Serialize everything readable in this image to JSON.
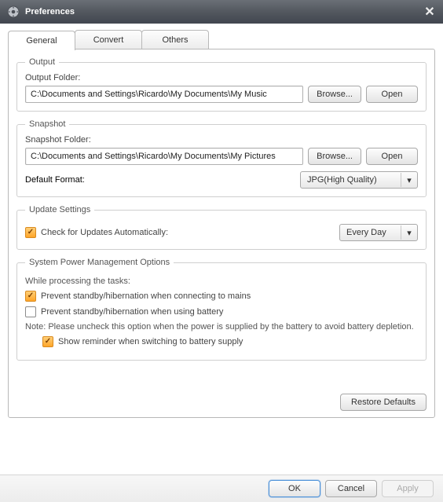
{
  "title": "Preferences",
  "tabs": {
    "general": "General",
    "convert": "Convert",
    "others": "Others"
  },
  "output": {
    "legend": "Output",
    "folder_label": "Output Folder:",
    "folder_value": "C:\\Documents and Settings\\Ricardo\\My Documents\\My Music",
    "browse": "Browse...",
    "open": "Open"
  },
  "snapshot": {
    "legend": "Snapshot",
    "folder_label": "Snapshot Folder:",
    "folder_value": "C:\\Documents and Settings\\Ricardo\\My Documents\\My Pictures",
    "browse": "Browse...",
    "open": "Open",
    "default_format_label": "Default Format:",
    "default_format_value": "JPG(High Quality)"
  },
  "update": {
    "legend": "Update Settings",
    "check_label": "Check for Updates Automatically:",
    "check_checked": true,
    "freq_value": "Every Day"
  },
  "power": {
    "legend": "System Power Management Options",
    "while_label": "While processing the tasks:",
    "opt1_label": "Prevent standby/hibernation when connecting to mains",
    "opt1_checked": true,
    "opt2_label": "Prevent standby/hibernation when using battery",
    "opt2_checked": false,
    "note": "Note: Please uncheck this option when the power is supplied by the battery to avoid battery depletion.",
    "opt3_label": "Show reminder when switching to battery supply",
    "opt3_checked": true
  },
  "restore_defaults": "Restore Defaults",
  "footer": {
    "ok": "OK",
    "cancel": "Cancel",
    "apply": "Apply"
  }
}
